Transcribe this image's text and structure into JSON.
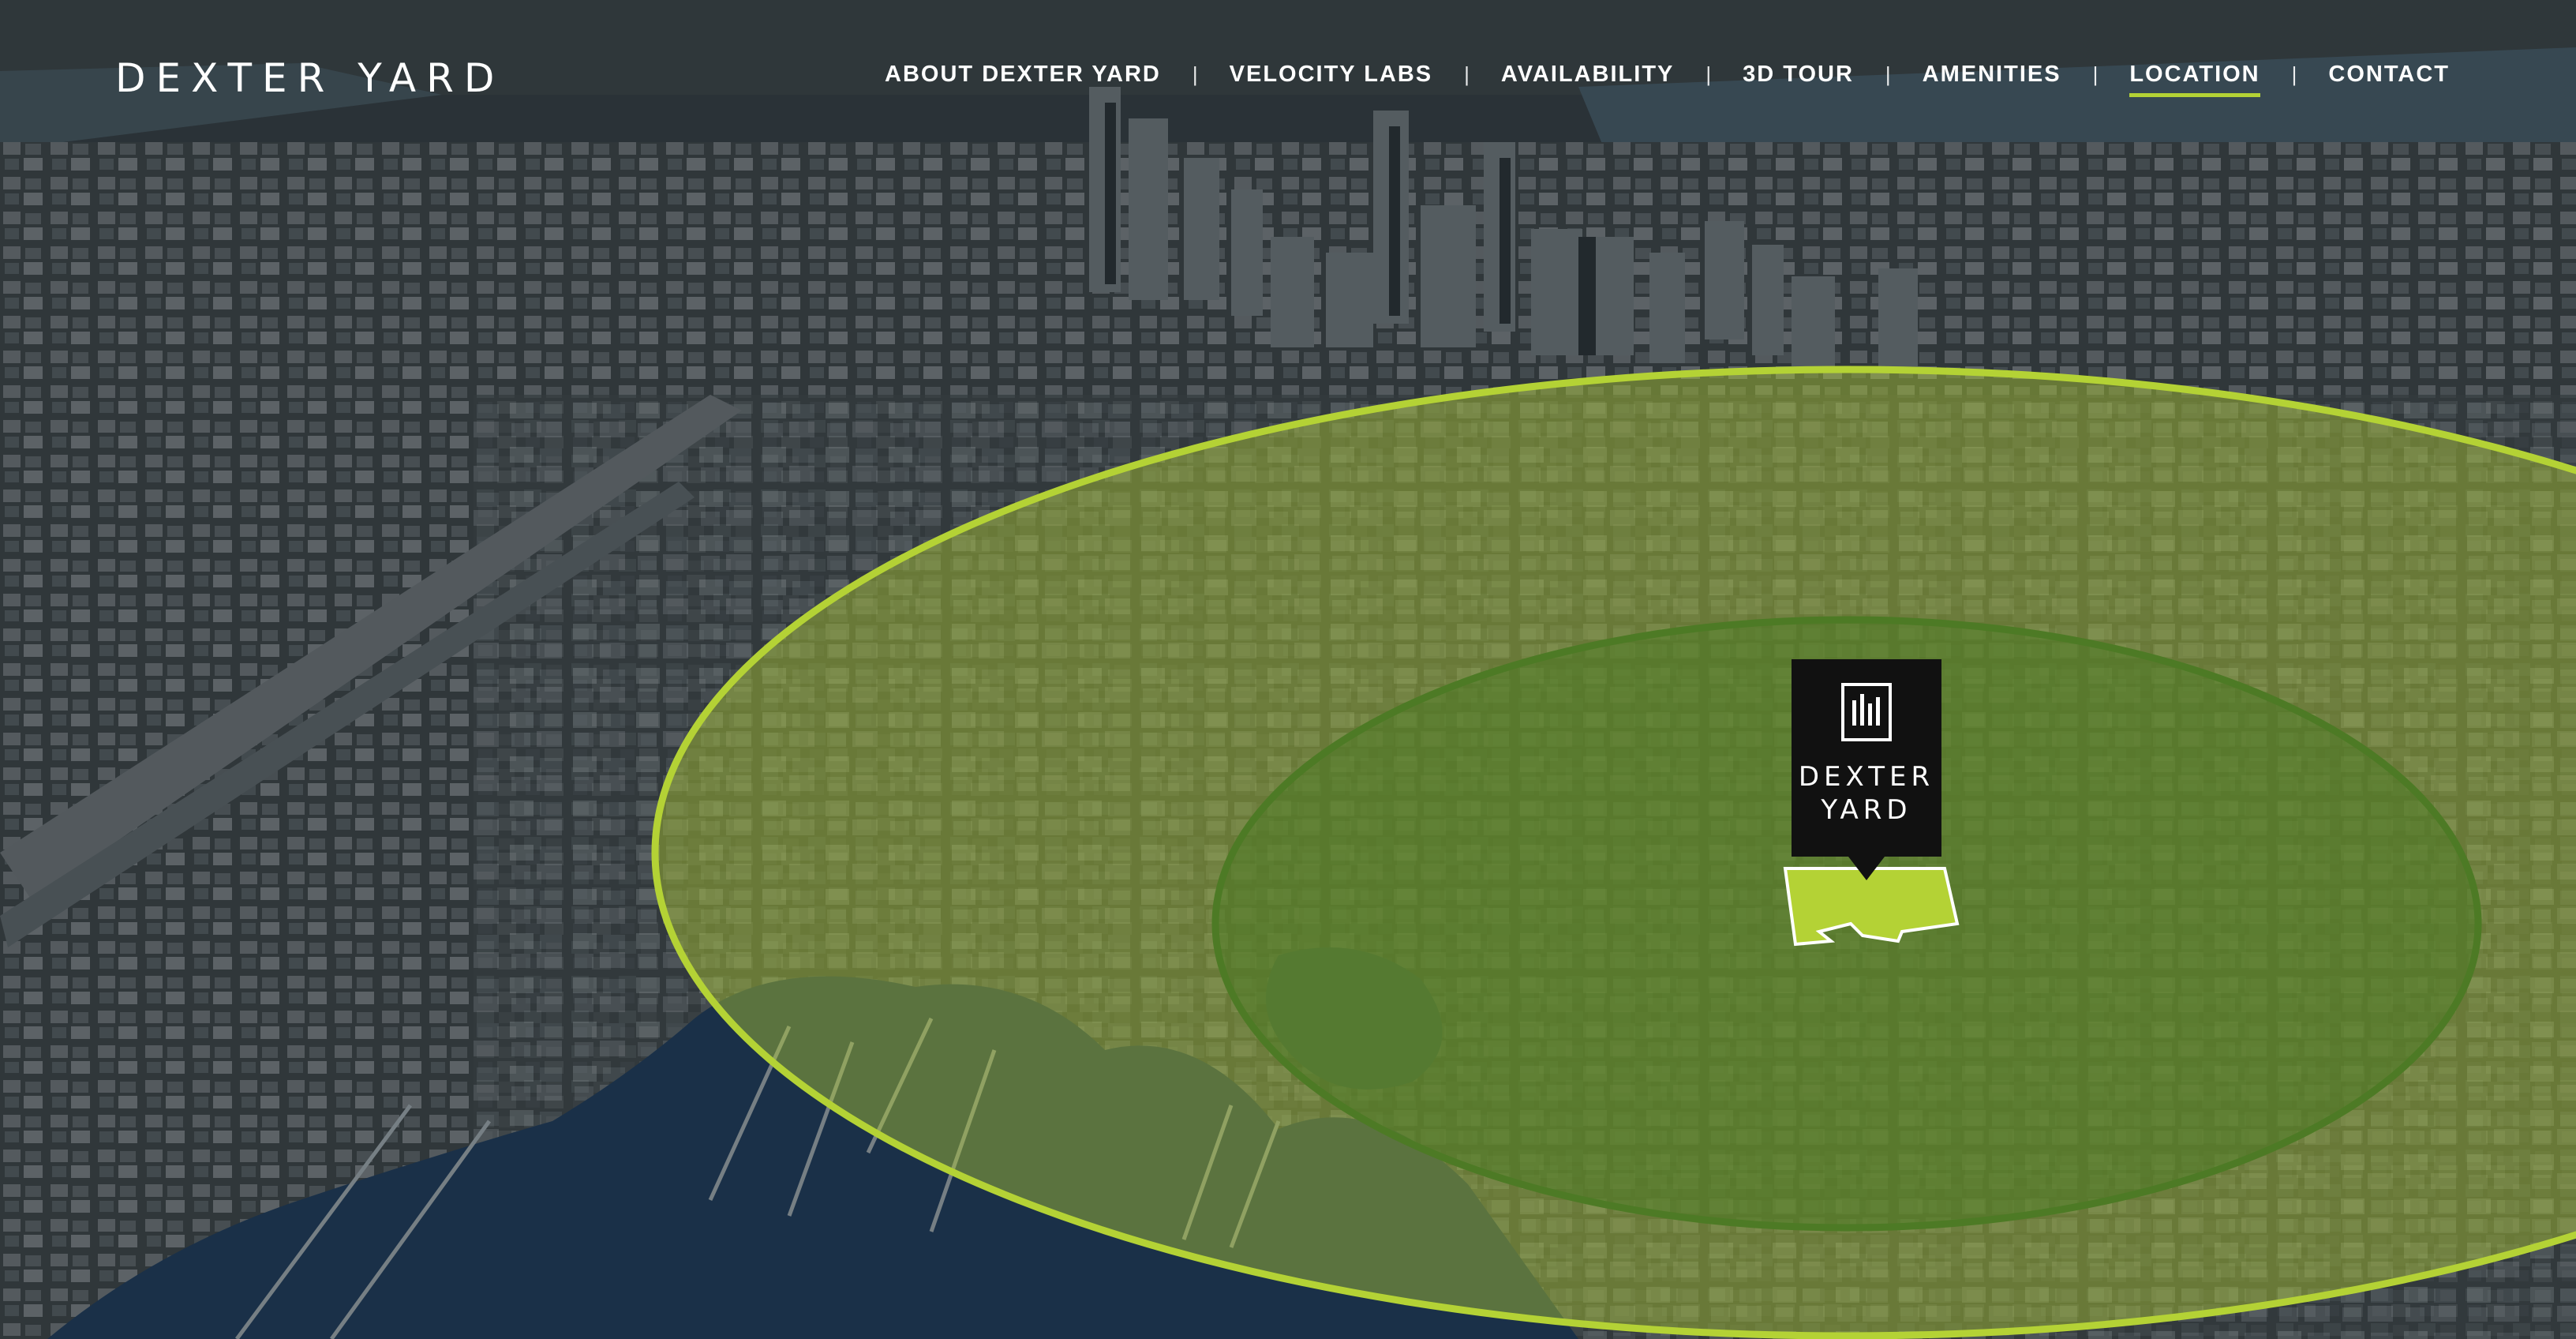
{
  "brand": {
    "logo_text": "DEXTER YARD"
  },
  "nav": {
    "items": [
      {
        "label": "ABOUT DEXTER YARD",
        "active": false
      },
      {
        "label": "VELOCITY LABS",
        "active": false
      },
      {
        "label": "AVAILABILITY",
        "active": false
      },
      {
        "label": "3D TOUR",
        "active": false
      },
      {
        "label": "AMENITIES",
        "active": false
      },
      {
        "label": "LOCATION",
        "active": true
      },
      {
        "label": "CONTACT",
        "active": false
      }
    ],
    "separator": "|"
  },
  "map": {
    "marker": {
      "line1": "DEXTER",
      "line2": "YARD",
      "icon": "building-logo-icon"
    },
    "colors": {
      "accent": "#b4d235",
      "outer_ring": "#b4d235",
      "inner_ring": "#4d7a25",
      "site_fill": "#b4d235",
      "marker_bg": "#111111"
    }
  }
}
